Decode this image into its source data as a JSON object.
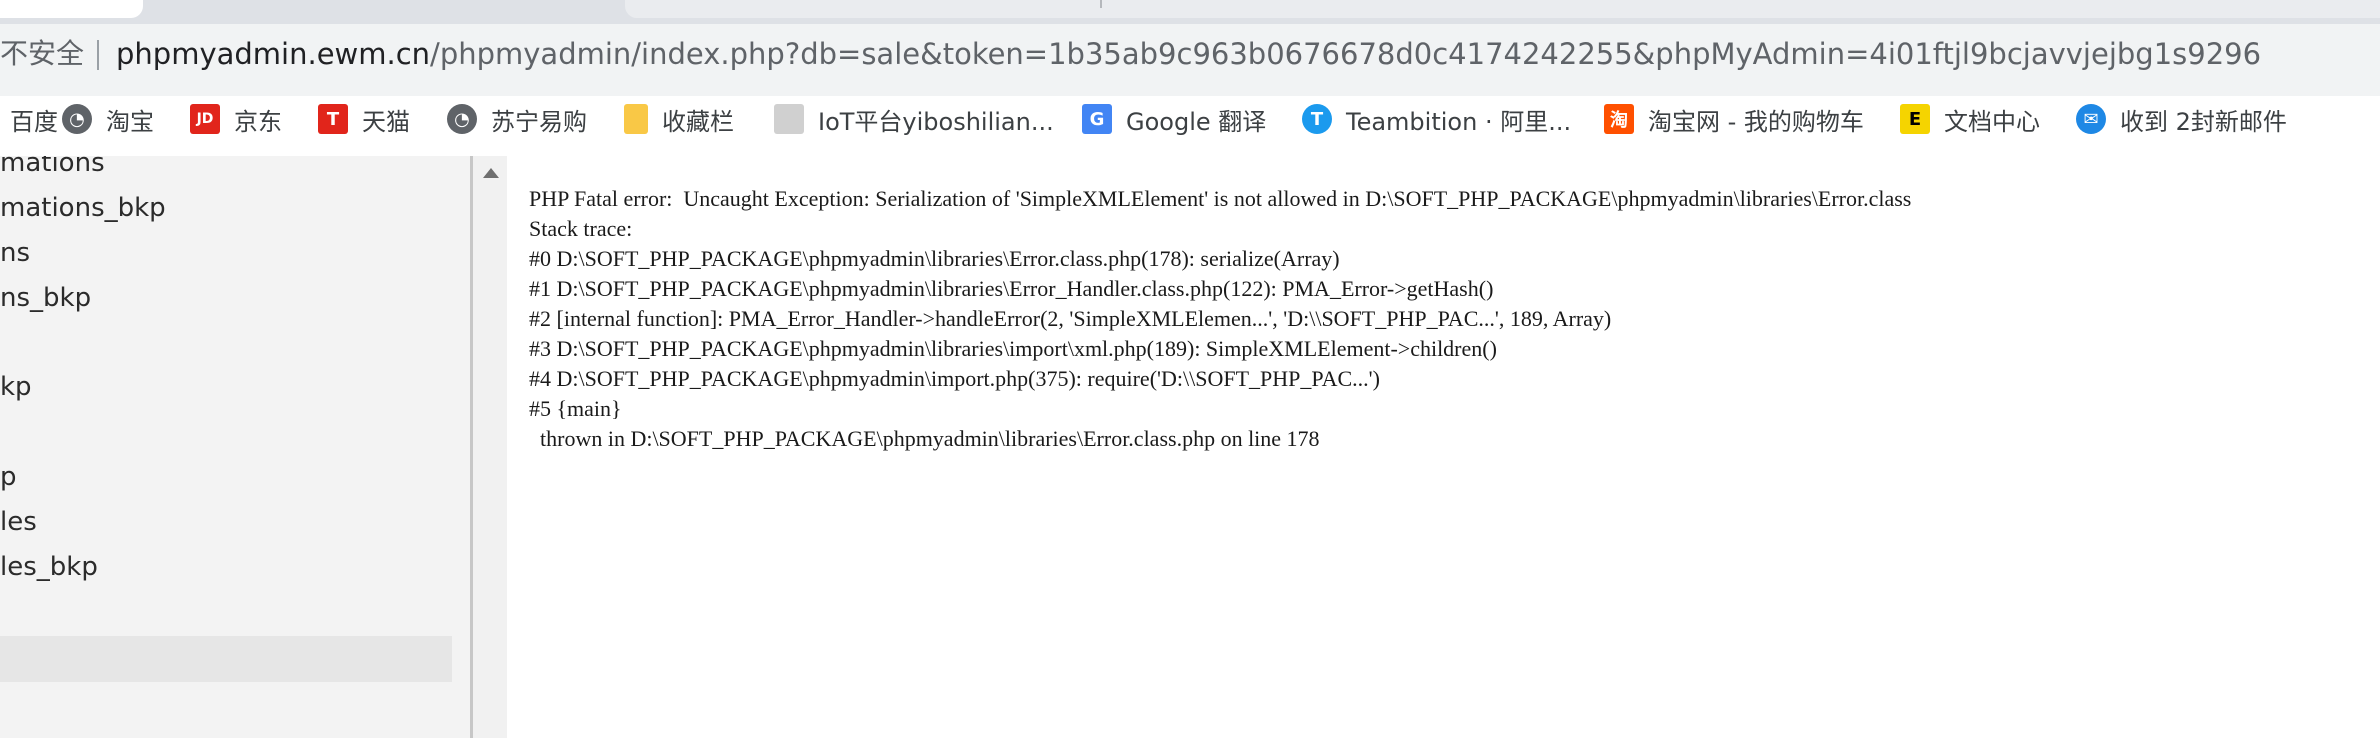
{
  "browser": {
    "security_label": "不安全",
    "url_host": "phpmyadmin.ewm.cn",
    "url_rest": "/phpmyadmin/index.php?db=sale&token=1b35ab9c963b0676678d0c4174242255&phpMyAdmin=4i01ftjl9bcjavvjejbg1s9296"
  },
  "bookmarks": [
    {
      "label": "百度",
      "icon": "baidu-icon",
      "color": "#2932e1"
    },
    {
      "label": "淘宝",
      "icon": "globe-icon",
      "color": "#5f6368"
    },
    {
      "label": "京东",
      "icon": "jd-icon",
      "color": "#e1251b"
    },
    {
      "label": "天猫",
      "icon": "tmall-icon",
      "color": "#e1251b"
    },
    {
      "label": "苏宁易购",
      "icon": "globe-icon",
      "color": "#5f6368"
    },
    {
      "label": "收藏栏",
      "icon": "folder-icon",
      "color": "#f9c846"
    },
    {
      "label": "IoT平台yiboshilian...",
      "icon": "iot-icon",
      "color": "#cccccc"
    },
    {
      "label": "Google 翻译",
      "icon": "google-translate-icon",
      "color": "#4285f4"
    },
    {
      "label": "Teambition · 阿里...",
      "icon": "teambition-icon",
      "color": "#1b9aee"
    },
    {
      "label": "淘宝网 - 我的购物车",
      "icon": "taobao-icon",
      "color": "#ff5000"
    },
    {
      "label": "文档中心",
      "icon": "doc-center-icon",
      "color": "#f5d400"
    },
    {
      "label": "收到 2封新邮件",
      "icon": "mail-icon",
      "color": "#1e88e5"
    }
  ],
  "sidebar": {
    "items": [
      "mations",
      "mations_bkp",
      "ns",
      "ns_bkp",
      "kp",
      "p",
      "les",
      "les_bkp"
    ]
  },
  "error": {
    "lines": [
      "PHP Fatal error:  Uncaught Exception: Serialization of 'SimpleXMLElement' is not allowed in D:\\SOFT_PHP_PACKAGE\\phpmyadmin\\libraries\\Error.class",
      "Stack trace:",
      "#0 D:\\SOFT_PHP_PACKAGE\\phpmyadmin\\libraries\\Error.class.php(178): serialize(Array)",
      "#1 D:\\SOFT_PHP_PACKAGE\\phpmyadmin\\libraries\\Error_Handler.class.php(122): PMA_Error->getHash()",
      "#2 [internal function]: PMA_Error_Handler->handleError(2, 'SimpleXMLElemen...', 'D:\\\\SOFT_PHP_PAC...', 189, Array)",
      "#3 D:\\SOFT_PHP_PACKAGE\\phpmyadmin\\libraries\\import\\xml.php(189): SimpleXMLElement->children()",
      "#4 D:\\SOFT_PHP_PACKAGE\\phpmyadmin\\import.php(375): require('D:\\\\SOFT_PHP_PAC...')",
      "#5 {main}",
      "  thrown in D:\\SOFT_PHP_PACKAGE\\phpmyadmin\\libraries\\Error.class.php on line 178"
    ]
  }
}
